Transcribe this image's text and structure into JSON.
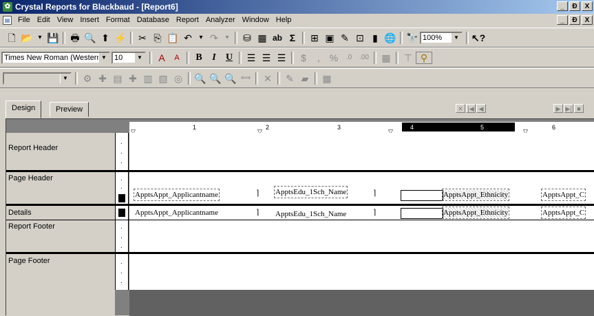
{
  "window": {
    "title": "Crystal Reports for Blackbaud - [Report6]",
    "app_icon": "crystal-reports-icon",
    "buttons": [
      "_",
      "Ɖ",
      "X"
    ]
  },
  "menubar": {
    "items": [
      "File",
      "Edit",
      "View",
      "Insert",
      "Format",
      "Database",
      "Report",
      "Analyzer",
      "Window",
      "Help"
    ],
    "mdi_buttons": [
      "_",
      "Ɖ",
      "X"
    ]
  },
  "toolbar1": {
    "zoom": "100%"
  },
  "toolbar2": {
    "font_name": "Times New Roman (Western",
    "font_size": "10"
  },
  "tabs": {
    "design": "Design",
    "preview": "Preview"
  },
  "ruler": {
    "marks": [
      "1",
      "2",
      "3",
      "4",
      "5",
      "6"
    ]
  },
  "sections": {
    "report_header": "Report Header",
    "page_header": "Page Header",
    "details": "Details",
    "report_footer": "Report Footer",
    "page_footer": "Page Footer"
  },
  "fields": {
    "ph_applicant": "ApptsAppt_Applicantname",
    "ph_school": "ApptsEdu_1Sch_Name",
    "ph_ethnicity": "ApptsAppt_Ethnicity",
    "ph_next": "ApptsAppt_C",
    "d_applicant": "ApptsAppt_Applicantname",
    "d_school": "ApptsEdu_1Sch_Name",
    "d_ethnicity": "ApptsAppt_Ethnicity",
    "d_next": "ApptsAppt_C"
  }
}
